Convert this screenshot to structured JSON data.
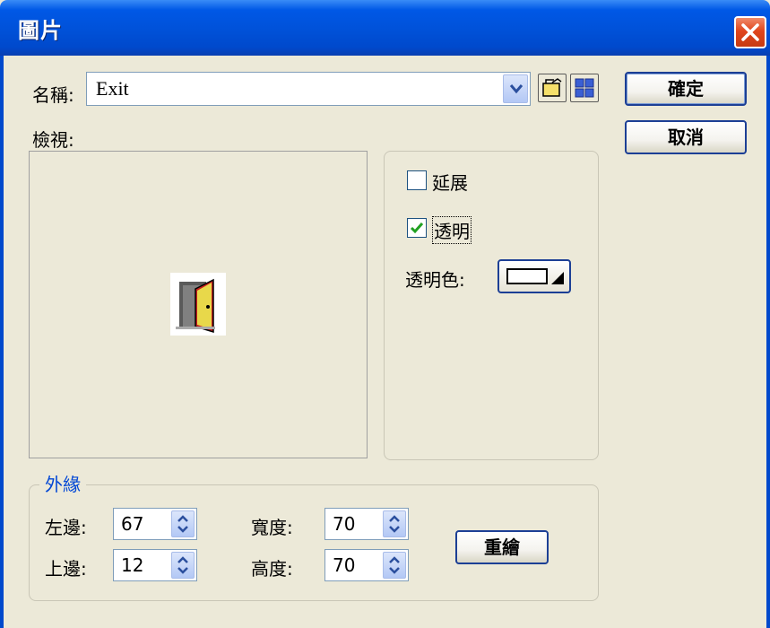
{
  "dialog": {
    "title": "圖片",
    "name_label": "名稱:",
    "name_value": "Exit",
    "preview_label": "檢視:",
    "buttons": {
      "ok": "確定",
      "cancel": "取消",
      "redraw": "重繪"
    },
    "options": {
      "stretch": {
        "label": "延展",
        "checked": false
      },
      "transparent": {
        "label": "透明",
        "checked": true
      },
      "transparent_color_label": "透明色:",
      "transparent_color": "#ffffff"
    },
    "border_group": {
      "title": "外緣",
      "left": {
        "label": "左邊:",
        "value": "67"
      },
      "top": {
        "label": "上邊:",
        "value": "12"
      },
      "width": {
        "label": "寬度:",
        "value": "70"
      },
      "height": {
        "label": "高度:",
        "value": "70"
      }
    },
    "icons": {
      "close": "close-icon",
      "dropdown": "chevron-down-icon",
      "open_folder": "open-folder-icon",
      "browse": "grid-icon",
      "preview_image": "exit-door-icon"
    },
    "colors": {
      "titlebar": "#0058e6",
      "group_title": "#0046d5",
      "face": "#ece9d8"
    }
  }
}
